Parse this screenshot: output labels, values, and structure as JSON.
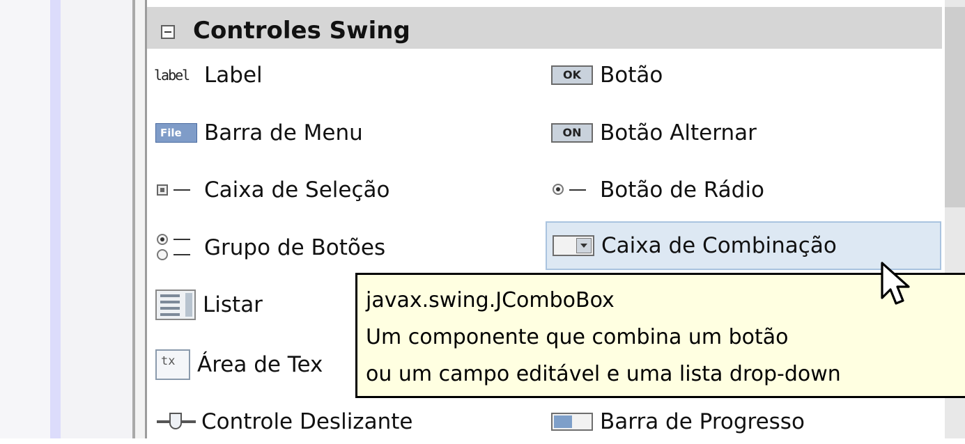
{
  "category": {
    "title": "Controles Swing"
  },
  "items": [
    {
      "icon": "label-component-icon",
      "icon_text": "label",
      "label": "Label"
    },
    {
      "icon": "button-component-icon",
      "icon_text": "OK",
      "label": "Botão"
    },
    {
      "icon": "menu-bar-icon",
      "icon_text": "File",
      "label": "Barra de Menu"
    },
    {
      "icon": "toggle-button-icon",
      "icon_text": "ON",
      "label": "Botão Alternar"
    },
    {
      "icon": "checkbox-icon",
      "label": "Caixa de Seleção"
    },
    {
      "icon": "radio-button-icon",
      "label": "Botão de Rádio"
    },
    {
      "icon": "button-group-icon",
      "label": "Grupo de Botões"
    },
    {
      "icon": "combo-box-icon",
      "label": "Caixa de Combinação"
    },
    {
      "icon": "list-icon",
      "label": "Listar"
    },
    {
      "icon": "text-area-icon",
      "icon_text": "tx",
      "label": "Área de Tex"
    },
    {
      "icon": "slider-icon",
      "label": "Controle Deslizante"
    },
    {
      "icon": "progress-bar-icon",
      "label": "Barra de Progresso"
    }
  ],
  "tooltip": {
    "class_name": "javax.swing.JComboBox",
    "description_line1": "Um componente que combina um botão",
    "description_line2": "ou um campo editável e uma lista drop-down"
  },
  "colors": {
    "header_bg": "#d6d6d6",
    "hover_bg": "#dde8f3",
    "tooltip_bg": "#ffffe1"
  }
}
